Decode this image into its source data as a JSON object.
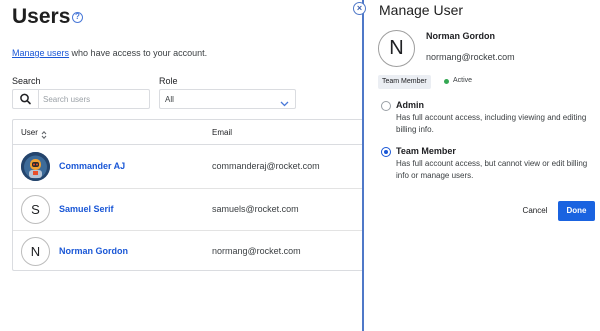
{
  "page": {
    "title": "Users",
    "subtitle_link": "Manage users",
    "subtitle_rest": " who have access to your account."
  },
  "filters": {
    "search_label": "Search",
    "search_placeholder": "Search users",
    "role_label": "Role",
    "role_value": "All"
  },
  "table": {
    "col_user": "User",
    "col_email": "Email",
    "rows": [
      {
        "name": "Commander AJ",
        "email": "commanderaj@rocket.com",
        "initial": ""
      },
      {
        "name": "Samuel Serif",
        "email": "samuels@rocket.com",
        "initial": "S"
      },
      {
        "name": "Norman Gordon",
        "email": "normang@rocket.com",
        "initial": "N"
      }
    ]
  },
  "drawer": {
    "close_symbol": "×",
    "title": "Manage User",
    "avatar_initial": "N",
    "user_name": "Norman Gordon",
    "user_email": "normang@rocket.com",
    "role_badge": "Team Member",
    "status": "Active",
    "options": [
      {
        "label": "Admin",
        "description": "Has full account access, including viewing and editing billing info.",
        "selected": false
      },
      {
        "label": "Team Member",
        "description": "Has full account access, but cannot view or edit billing info or manage users.",
        "selected": true
      }
    ],
    "cancel_label": "Cancel",
    "done_label": "Done"
  },
  "colors": {
    "accent": "#1a57d6",
    "primary_button": "#1a63e0",
    "status_active": "#34a853"
  }
}
